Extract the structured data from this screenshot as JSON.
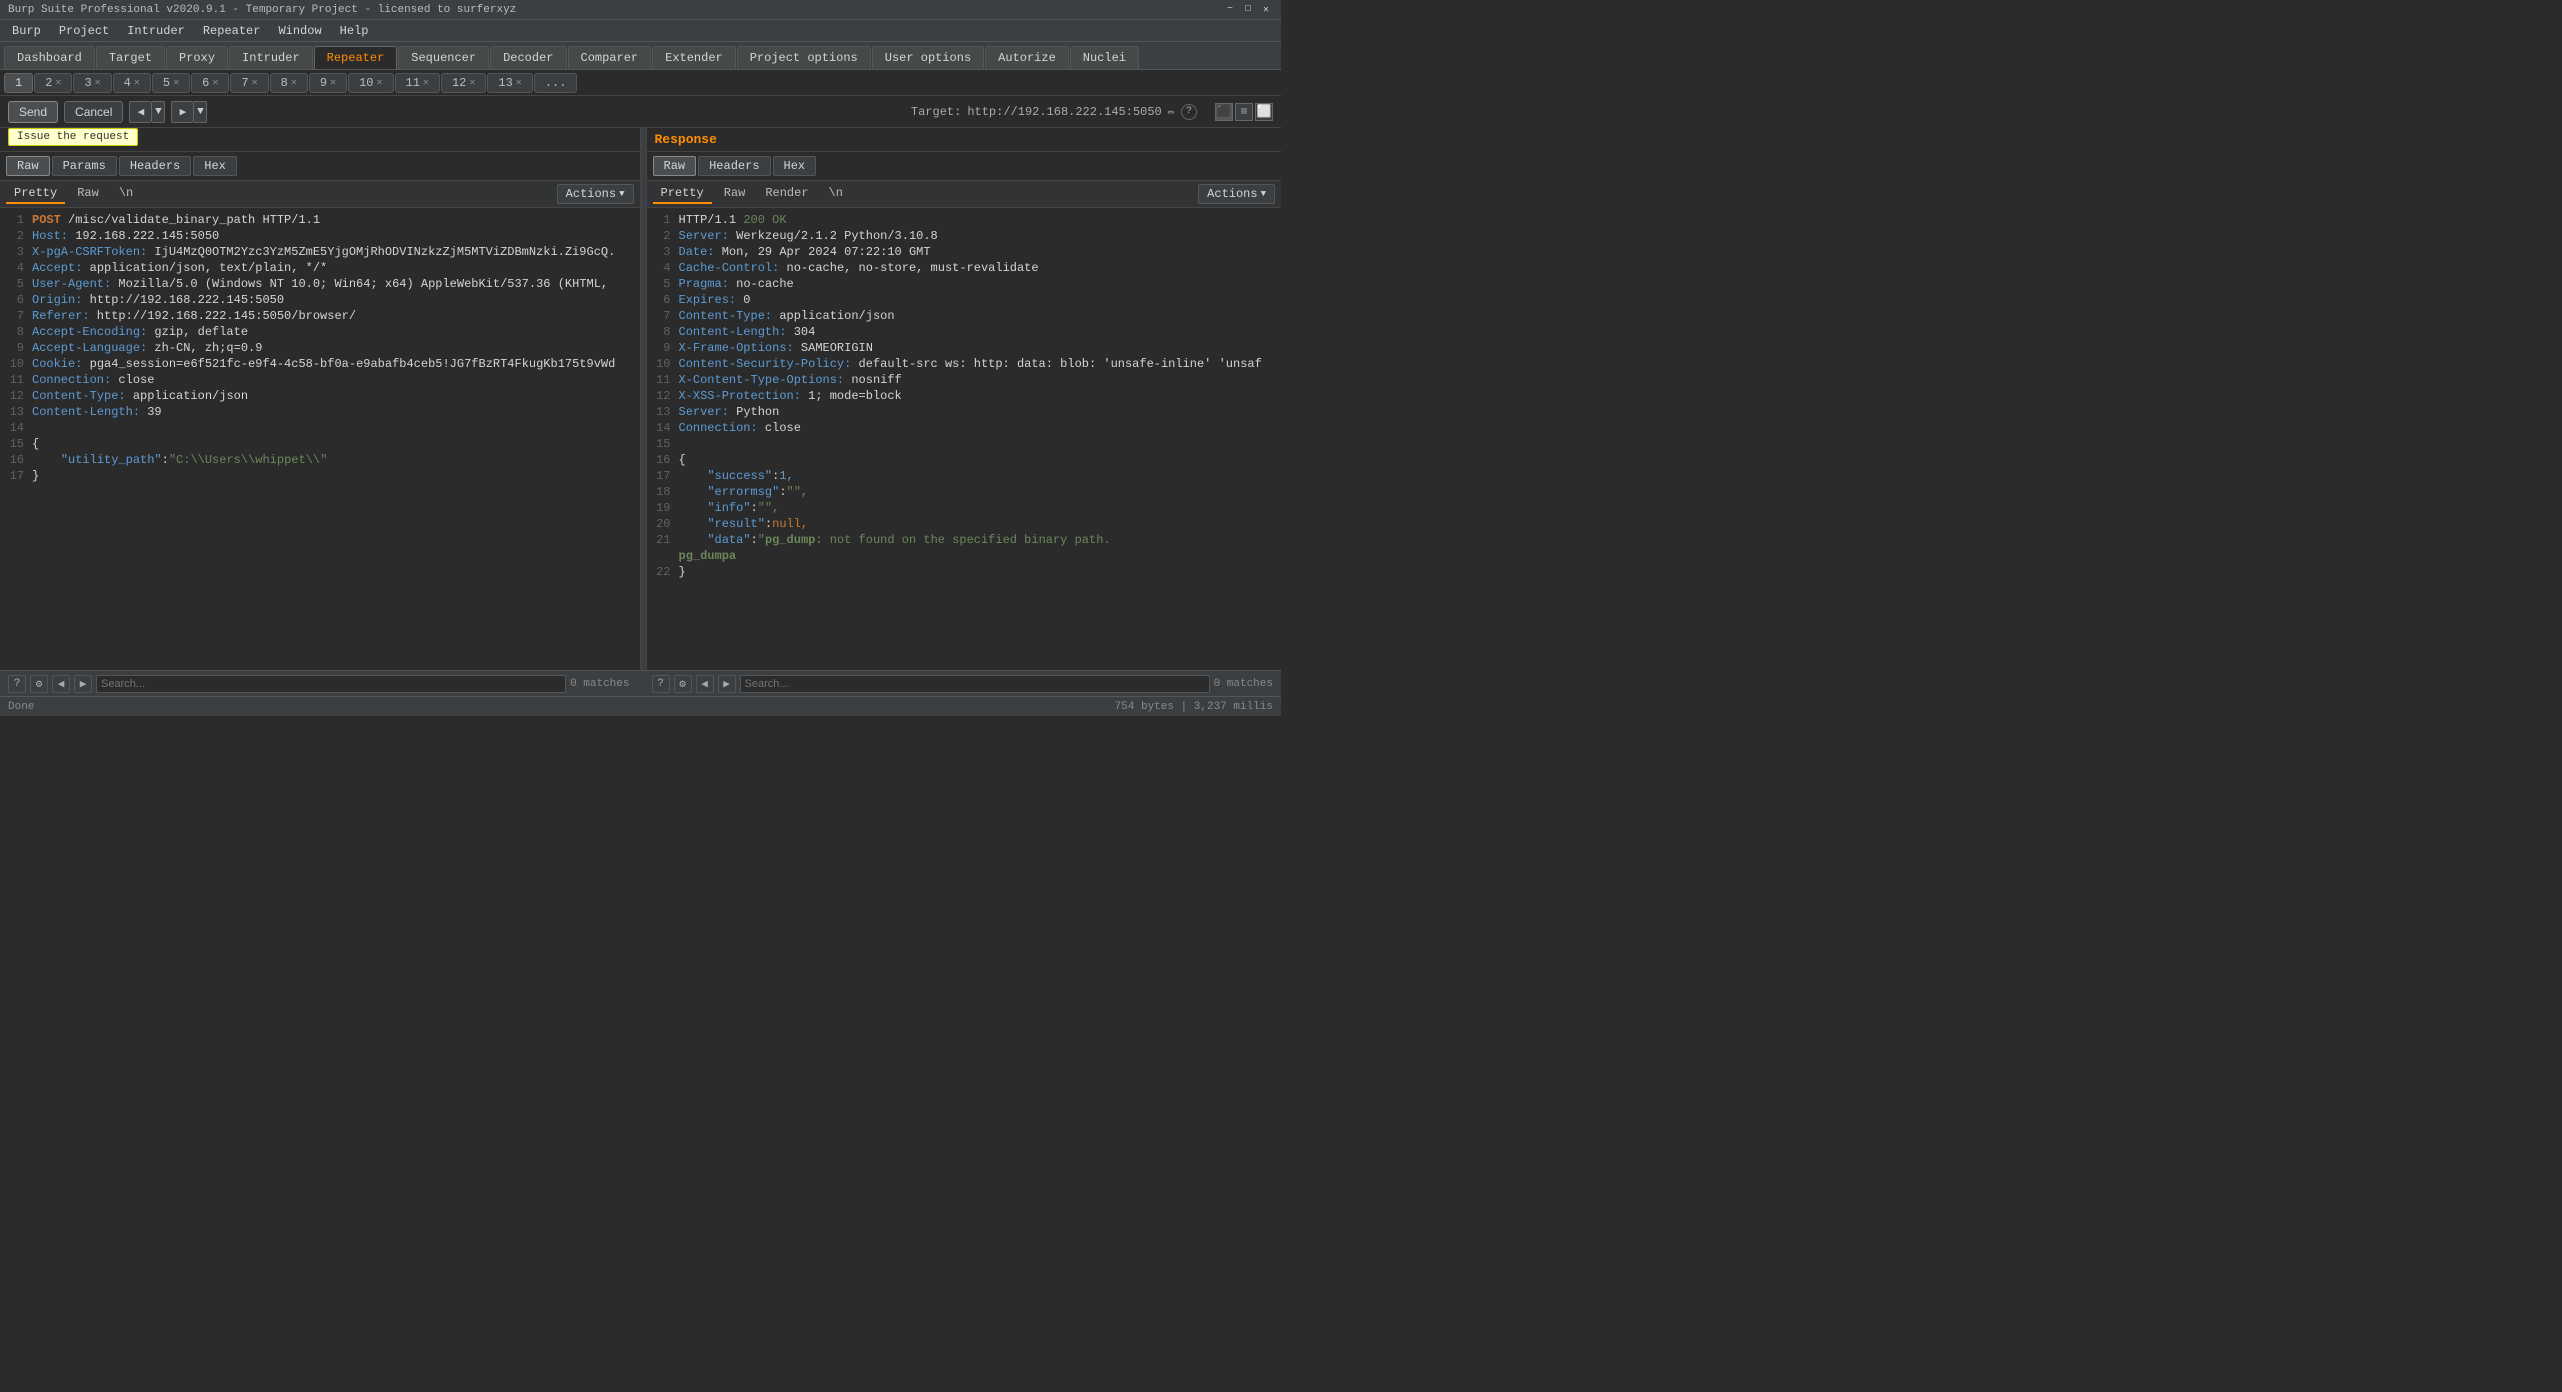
{
  "title_bar": {
    "text": "Burp Suite Professional v2020.9.1 - Temporary Project - licensed to surferxyz",
    "min": "−",
    "max": "□",
    "close": "✕"
  },
  "menu": {
    "items": [
      "Burp",
      "Project",
      "Intruder",
      "Repeater",
      "Window",
      "Help"
    ]
  },
  "nav_tabs": {
    "items": [
      "Dashboard",
      "Target",
      "Proxy",
      "Intruder",
      "Repeater",
      "Sequencer",
      "Decoder",
      "Comparer",
      "Extender",
      "Project options",
      "User options",
      "Autorize",
      "Nuclei"
    ],
    "active": "Repeater"
  },
  "repeater_tabs": {
    "items": [
      "1",
      "2",
      "3",
      "4",
      "5",
      "6",
      "7",
      "8",
      "9",
      "10",
      "11",
      "12",
      "13",
      "..."
    ],
    "active": "1"
  },
  "toolbar": {
    "send_label": "Send",
    "cancel_label": "Cancel",
    "nav_prev": "◀",
    "nav_prev_arrow": "▼",
    "nav_next": "▶",
    "nav_next_arrow": "▼",
    "target_label": "Target:",
    "target_url": "http://192.168.222.145:5050",
    "tooltip": "Issue the request"
  },
  "request": {
    "panel_title": "Request",
    "format_tabs": [
      "Raw",
      "Params",
      "Headers",
      "Hex"
    ],
    "active_format": "Raw",
    "editor_tabs": [
      "Pretty",
      "Raw",
      "\\n"
    ],
    "active_editor": "Pretty",
    "actions_label": "Actions",
    "lines": [
      {
        "num": 1,
        "type": "request-line",
        "content": "POST /misc/validate_binary_path HTTP/1.1"
      },
      {
        "num": 2,
        "type": "header",
        "name": "Host",
        "value": " 192.168.222.145:5050"
      },
      {
        "num": 3,
        "type": "header",
        "name": "X-pgA-CSRFToken",
        "value": " IjU4MzQ0OTM2Yzc3YzM5ZmE5YjgOMjRhODVINzkzZjM5MTViZDBmNzki.Zi9GcQ."
      },
      {
        "num": 4,
        "type": "header",
        "name": "Accept",
        "value": " application/json, text/plain, */*"
      },
      {
        "num": 5,
        "type": "header",
        "name": "User-Agent",
        "value": " Mozilla/5.0 (Windows NT 10.0; Win64; x64) AppleWebKit/537.36 (KHTML,"
      },
      {
        "num": 6,
        "type": "header",
        "name": "Origin",
        "value": " http://192.168.222.145:5050"
      },
      {
        "num": 7,
        "type": "header",
        "name": "Referer",
        "value": " http://192.168.222.145:5050/browser/"
      },
      {
        "num": 8,
        "type": "header",
        "name": "Accept-Encoding",
        "value": " gzip, deflate"
      },
      {
        "num": 9,
        "type": "header",
        "name": "Accept-Language",
        "value": " zh-CN, zh;q=0.9"
      },
      {
        "num": 10,
        "type": "header",
        "name": "Cookie",
        "value": " pga4_session=e6f521fc-e9f4-4c58-bf0a-e9abafb4ceb5!JG7fBzRT4FkugKb175t9vWd"
      },
      {
        "num": 11,
        "type": "header",
        "name": "Connection",
        "value": " close"
      },
      {
        "num": 12,
        "type": "header",
        "name": "Content-Type",
        "value": " application/json"
      },
      {
        "num": 13,
        "type": "header",
        "name": "Content-Length",
        "value": " 39"
      },
      {
        "num": 14,
        "type": "blank",
        "content": ""
      },
      {
        "num": 15,
        "type": "json-open",
        "content": "{"
      },
      {
        "num": 16,
        "type": "json-body",
        "key": "\"utility_path\"",
        "value": "\"C:\\\\Users\\\\whippet\\\\\""
      },
      {
        "num": 17,
        "type": "json-close",
        "content": "}"
      }
    ]
  },
  "response": {
    "panel_title": "Response",
    "format_tabs": [
      "Raw",
      "Headers",
      "Hex"
    ],
    "active_format": "Raw",
    "editor_tabs": [
      "Pretty",
      "Raw",
      "Render",
      "\\n"
    ],
    "active_editor": "Pretty",
    "actions_label": "Actions",
    "lines": [
      {
        "num": 1,
        "type": "status",
        "content": "HTTP/1.1 200 OK"
      },
      {
        "num": 2,
        "type": "header",
        "name": "Server",
        "value": " Werkzeug/2.1.2 Python/3.10.8"
      },
      {
        "num": 3,
        "type": "header",
        "name": "Date",
        "value": " Mon, 29 Apr 2024 07:22:10 GMT"
      },
      {
        "num": 4,
        "type": "header",
        "name": "Cache-Control",
        "value": " no-cache, no-store, must-revalidate"
      },
      {
        "num": 5,
        "type": "header",
        "name": "Pragma",
        "value": " no-cache"
      },
      {
        "num": 6,
        "type": "header",
        "name": "Expires",
        "value": " 0"
      },
      {
        "num": 7,
        "type": "header",
        "name": "Content-Type",
        "value": " application/json"
      },
      {
        "num": 8,
        "type": "header",
        "name": "Content-Length",
        "value": " 304"
      },
      {
        "num": 9,
        "type": "header",
        "name": "X-Frame-Options",
        "value": " SAMEORIGIN"
      },
      {
        "num": 10,
        "type": "header",
        "name": "Content-Security-Policy",
        "value": " default-src ws: http: data: blob: 'unsafe-inline' 'unsaf"
      },
      {
        "num": 11,
        "type": "header",
        "name": "X-Content-Type-Options",
        "value": " nosniff"
      },
      {
        "num": 12,
        "type": "header",
        "name": "X-XSS-Protection",
        "value": " 1; mode=block"
      },
      {
        "num": 13,
        "type": "header",
        "name": "Server",
        "value": " Python"
      },
      {
        "num": 14,
        "type": "header",
        "name": "Connection",
        "value": " close"
      },
      {
        "num": 15,
        "type": "blank",
        "content": ""
      },
      {
        "num": 16,
        "type": "json-open",
        "content": "{"
      },
      {
        "num": 17,
        "type": "json-key-val",
        "key": "\"success\"",
        "value": "1,"
      },
      {
        "num": 18,
        "type": "json-key-val",
        "key": "\"errormsg\"",
        "value": "\"\","
      },
      {
        "num": 19,
        "type": "json-key-val",
        "key": "\"info\"",
        "value": "\"\","
      },
      {
        "num": 20,
        "type": "json-key-val",
        "key": "\"result\"",
        "value": "null,"
      },
      {
        "num": 21,
        "type": "json-key-val-long",
        "key": "\"data\"",
        "value": "\"<b>pg_dump:</b> not found on the specified binary path.<br/><b>pg_dumpa"
      },
      {
        "num": 22,
        "type": "json-close",
        "content": "}"
      }
    ]
  },
  "bottom_left": {
    "search_placeholder": "Search...",
    "matches": "0 matches"
  },
  "bottom_right": {
    "search_placeholder": "Search...",
    "matches": "0 matches"
  },
  "status_bar": {
    "left": "Done",
    "right": "754 bytes | 3,237 millis"
  }
}
